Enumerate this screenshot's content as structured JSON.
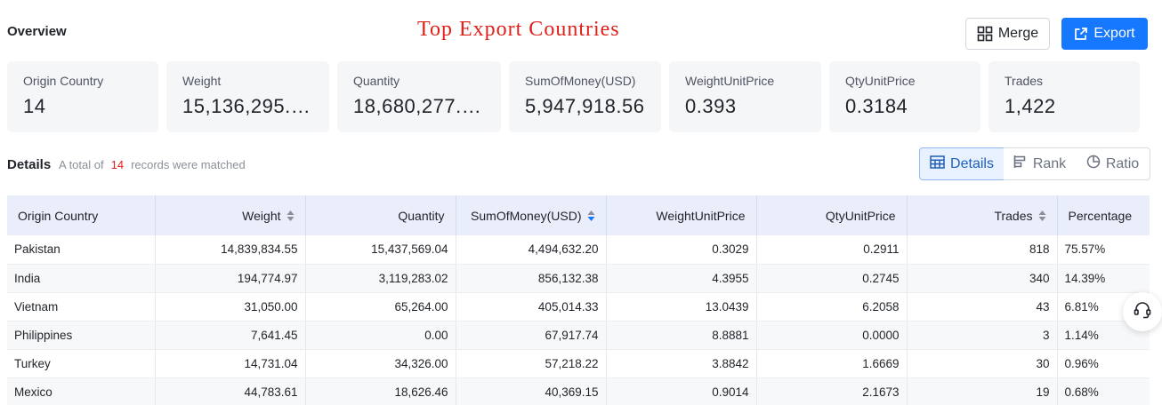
{
  "overview": {
    "title": "Overview"
  },
  "banner": {
    "title": "Top Export Countries"
  },
  "actions": {
    "merge_label": "Merge",
    "export_label": "Export"
  },
  "cards": [
    {
      "label": "Origin Country",
      "value": "14"
    },
    {
      "label": "Weight",
      "value": "15,136,295.…"
    },
    {
      "label": "Quantity",
      "value": "18,680,277.…"
    },
    {
      "label": "SumOfMoney(USD)",
      "value": "5,947,918.56"
    },
    {
      "label": "WeightUnitPrice",
      "value": "0.393"
    },
    {
      "label": "QtyUnitPrice",
      "value": "0.3184"
    },
    {
      "label": "Trades",
      "value": "1,422"
    }
  ],
  "details": {
    "title": "Details",
    "prefix": "A total of",
    "count": "14",
    "suffix": "records were matched"
  },
  "view_tabs": {
    "details": "Details",
    "rank": "Rank",
    "ratio": "Ratio",
    "active": "Details"
  },
  "table": {
    "headers": [
      "Origin Country",
      "Weight",
      "Quantity",
      "SumOfMoney(USD)",
      "WeightUnitPrice",
      "QtyUnitPrice",
      "Trades",
      "Percentage"
    ],
    "rows": [
      [
        "Pakistan",
        "14,839,834.55",
        "15,437,569.04",
        "4,494,632.20",
        "0.3029",
        "0.2911",
        "818",
        "75.57%"
      ],
      [
        "India",
        "194,774.97",
        "3,119,283.02",
        "856,132.38",
        "4.3955",
        "0.2745",
        "340",
        "14.39%"
      ],
      [
        "Vietnam",
        "31,050.00",
        "65,264.00",
        "405,014.33",
        "13.0439",
        "6.2058",
        "43",
        "6.81%"
      ],
      [
        "Philippines",
        "7,641.45",
        "0.00",
        "67,917.74",
        "8.8881",
        "0.0000",
        "3",
        "1.14%"
      ],
      [
        "Turkey",
        "14,731.04",
        "34,326.00",
        "57,218.22",
        "3.8842",
        "1.6669",
        "30",
        "0.96%"
      ],
      [
        "Mexico",
        "44,783.61",
        "18,626.46",
        "40,369.15",
        "0.9014",
        "2.1673",
        "19",
        "0.68%"
      ]
    ]
  },
  "colors": {
    "accent": "#1677ff",
    "highlight": "#e0211a",
    "header_bg": "#eaeefb"
  }
}
